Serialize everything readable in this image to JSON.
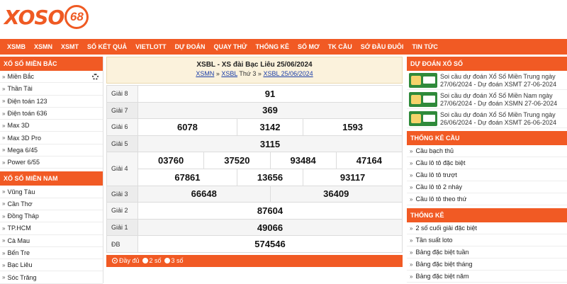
{
  "logo": {
    "text": "XOSO",
    "num": "68"
  },
  "nav": [
    "XSMB",
    "XSMN",
    "XSMT",
    "SỐ KẾT QUẢ",
    "VIETLOTT",
    "DỰ ĐOÁN",
    "QUAY THỬ",
    "THỐNG KÊ",
    "SỔ MƠ",
    "TK CẦU",
    "SỚ ĐẦU ĐUÔI",
    "TIN TỨC"
  ],
  "left": {
    "mb_title": "XỔ SỐ MIỀN BẮC",
    "mb_items": [
      "Miền Bắc",
      "Thần Tài",
      "Điện toán 123",
      "Điện toán 636",
      "Max 3D",
      "Max 3D Pro",
      "Mega 6/45",
      "Power 6/55"
    ],
    "mn_title": "XỔ SỐ MIỀN NAM",
    "mn_items": [
      "Vũng Tàu",
      "Cần Thơ",
      "Đồng Tháp",
      "TP.HCM",
      "Cà Mau",
      "Bến Tre",
      "Bạc Liêu",
      "Sóc Trăng"
    ]
  },
  "result": {
    "title": "XSBL - XS đài Bạc Liêu 25/06/2024",
    "crumb1": "XSMN",
    "crumb2": "XSBL",
    "crumb_mid": "Thứ 3",
    "crumb3": "XSBL 25/06/2024",
    "labels": {
      "g8": "Giải 8",
      "g7": "Giải 7",
      "g6": "Giải 6",
      "g5": "Giải 5",
      "g4": "Giải 4",
      "g3": "Giải 3",
      "g2": "Giải 2",
      "g1": "Giải 1",
      "db": "ĐB"
    },
    "g8": "91",
    "g7": "369",
    "g6": [
      "6078",
      "3142",
      "1593"
    ],
    "g5": "3115",
    "g4a": [
      "03760",
      "37520",
      "93484",
      "47164"
    ],
    "g4b": [
      "67861",
      "13656",
      "93117"
    ],
    "g3": [
      "66648",
      "36409"
    ],
    "g2": "87604",
    "g1": "49066",
    "db": "574546",
    "options": [
      "Đầy đủ",
      "2 số",
      "3 số"
    ]
  },
  "right": {
    "predict_title": "DỰ ĐOÁN XỔ SỐ",
    "news": [
      "Soi cầu dự đoán Xổ Số Miền Trung ngày 27/06/2024 - Dự đoán XSMT 27-06-2024",
      "Soi cầu dự đoán Xổ Số Miền Nam ngày 27/06/2024 - Dự đoán XSMN 27-06-2024",
      "Soi cầu dự đoán Xổ Số Miền Trung ngày 26/06/2024 - Dự đoán XSMT 26-06-2024"
    ],
    "cau_title": "THỐNG KÊ CẦU",
    "cau_items": [
      "Cầu bạch thủ",
      "Cầu lô tô đặc biệt",
      "Cầu lô tô trượt",
      "Cầu lô tô 2 nháy",
      "Cầu lô tô theo thứ"
    ],
    "tk_title": "THỐNG KÊ",
    "tk_items": [
      "2 số cuối giải đặc biệt",
      "Tần suất loto",
      "Bảng đặc biệt tuần",
      "Bảng đặc biệt tháng",
      "Bảng đặc biệt năm"
    ]
  },
  "colors": {
    "brand": "#f15a24",
    "header_bg": "#fbf2dc"
  }
}
